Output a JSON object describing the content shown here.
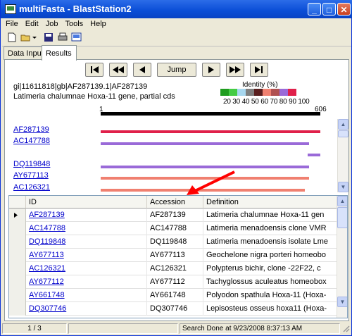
{
  "window": {
    "title": "multiFasta - BlastStation2"
  },
  "menu": [
    "File",
    "Edit",
    "Job",
    "Tools",
    "Help"
  ],
  "tabs": [
    {
      "label": "Data Input",
      "active": false
    },
    {
      "label": "Results",
      "active": true
    }
  ],
  "nav": {
    "jump_label": "Jump"
  },
  "query": {
    "line1": "gi|11611818|gb|AF287139.1|AF287139",
    "line2": "Latimeria chalumnae Hoxa-11 gene, partial cds"
  },
  "legend": {
    "title": "Identity (%)",
    "labels": "20 30 40 50 60 70 80 90 100",
    "colors": [
      "#1f9c1f",
      "#44cc44",
      "#a8d8f0",
      "#7f7f7f",
      "#5a1f1f",
      "#f08070",
      "#b05050",
      "#9a6ad8",
      "#e0204a"
    ]
  },
  "ruler": {
    "start": "1",
    "end": "606"
  },
  "hits": [
    {
      "id": "AF287139",
      "color": "#e0204a"
    },
    {
      "id": "AC147788",
      "color": "#9a6ad8"
    },
    {
      "id": "DQ119848",
      "color": "#9a6ad8"
    },
    {
      "id": "AY677113",
      "color": "#f08070"
    },
    {
      "id": "AC126321",
      "color": "#f08070"
    }
  ],
  "table": {
    "columns": [
      "ID",
      "Accession",
      "Definition"
    ],
    "rows": [
      {
        "id": "AF287139",
        "accession": "AF287139",
        "definition": "Latimeria chalumnae Hoxa-11 gen"
      },
      {
        "id": "AC147788",
        "accession": "AC147788",
        "definition": "Latimeria menadoensis clone VMR"
      },
      {
        "id": "DQ119848",
        "accession": "DQ119848",
        "definition": "Latimeria menadoensis isolate Lme"
      },
      {
        "id": "AY677113",
        "accession": "AY677113",
        "definition": "Geochelone nigra porteri homeobo"
      },
      {
        "id": "AC126321",
        "accession": "AC126321",
        "definition": "Polypterus bichir, clone -22F22, c"
      },
      {
        "id": "AY677112",
        "accession": "AY677112",
        "definition": "Tachyglossus aculeatus homeobox"
      },
      {
        "id": "AY661748",
        "accession": "AY661748",
        "definition": "Polyodon spathula Hoxa-11 (Hoxa-"
      },
      {
        "id": "DQ307746",
        "accession": "DQ307746",
        "definition": "Lepisosteus osseus hoxa11 (Hoxa-"
      }
    ]
  },
  "status": {
    "page": "1 / 3",
    "message": "Search Done at  9/23/2008 8:37:13 AM"
  }
}
